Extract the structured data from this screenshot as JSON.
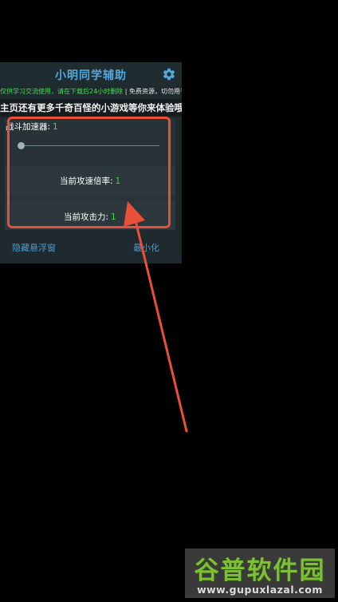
{
  "panel": {
    "title": "小明同学辅助",
    "notice_green": "仅供学习交流使用，请在下载后24小时删除",
    "notice_white": " | 免费资源，切勿用于",
    "marquee": "主页还有更多千奇百怪的小游戏等你来体验哦~"
  },
  "settings": {
    "speedup_label": "战斗加速器:",
    "speedup_value": "1",
    "attack_speed_label": "当前攻速倍率:",
    "attack_speed_value": "1",
    "attack_power_label": "当前攻击力:",
    "attack_power_value": "1"
  },
  "footer": {
    "hide_float": "隐藏悬浮窗",
    "minimize": "最小化"
  },
  "watermark": {
    "brand": "谷普软件园",
    "url": "www.gupuxlazal.com"
  },
  "colors": {
    "accent": "#4fa8e0",
    "value_green": "#46d34f",
    "highlight_red": "#e8503a"
  },
  "icons": {
    "settings": "gear-icon"
  }
}
